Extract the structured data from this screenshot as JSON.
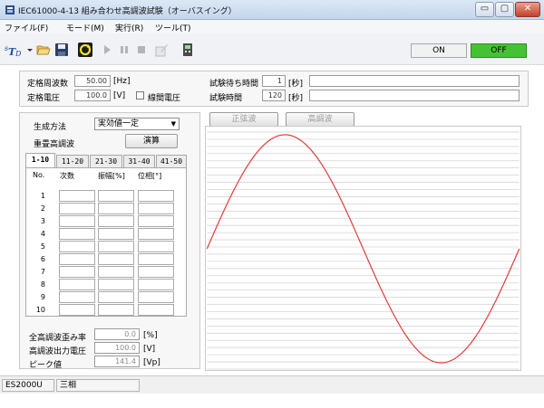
{
  "title": "IEC61000-4-13 組み合わせ高調波試験（オーバスイング）",
  "window_controls": {
    "minimize": "▭",
    "maximize": "▢",
    "close": "✕"
  },
  "menu": [
    "ファイル(F)",
    "モード(M)",
    "実行(R)",
    "ツール(T)"
  ],
  "toolbar": {
    "on_label": "ON",
    "off_label": "OFF",
    "icons": [
      "stp-icon",
      "open-folder-icon",
      "save-icon",
      "refresh-icon",
      "play-icon",
      "pause-icon",
      "stop-icon",
      "edit-icon",
      "meter-icon"
    ]
  },
  "colors": {
    "accent_off": "#45c234",
    "waveform": "#e33a3a"
  },
  "params": {
    "rated_freq_label": "定格周波数",
    "rated_freq_value": "50.00",
    "rated_freq_unit": "[Hz]",
    "rated_volt_label": "定格電圧",
    "rated_volt_value": "100.0",
    "rated_volt_unit": "[V]",
    "line_voltage_label": "線間電圧",
    "test_wait_label": "試験待ち時間",
    "test_wait_value": "1",
    "test_wait_unit": "[秒]",
    "test_time_label": "試験時間",
    "test_time_value": "120",
    "test_time_unit": "[秒]"
  },
  "left": {
    "gen_method_label": "生成方法",
    "gen_method_value": "実効値一定",
    "superimpose_label": "重畳高調波",
    "calc_button": "演算",
    "tabs": [
      "1-10",
      "11-20",
      "21-30",
      "31-40",
      "41-50"
    ],
    "columns": [
      "No.",
      "次数",
      "振幅[%]",
      "位相[°]"
    ],
    "rows": [
      "1",
      "2",
      "3",
      "4",
      "5",
      "6",
      "7",
      "8",
      "9",
      "10"
    ],
    "thd_label": "全高調波歪み率",
    "thd_value": "0.0",
    "thd_unit": "[%]",
    "harm_out_label": "高調波出力電圧",
    "harm_out_value": "100.0",
    "harm_out_unit": "[V]",
    "peak_label": "ピーク値",
    "peak_value": "141.4",
    "peak_unit": "[Vp]"
  },
  "plot": {
    "sine_button": "正弦波",
    "harmonic_button": "高調波"
  },
  "status": {
    "model": "ES2000U",
    "phase": "三相"
  }
}
